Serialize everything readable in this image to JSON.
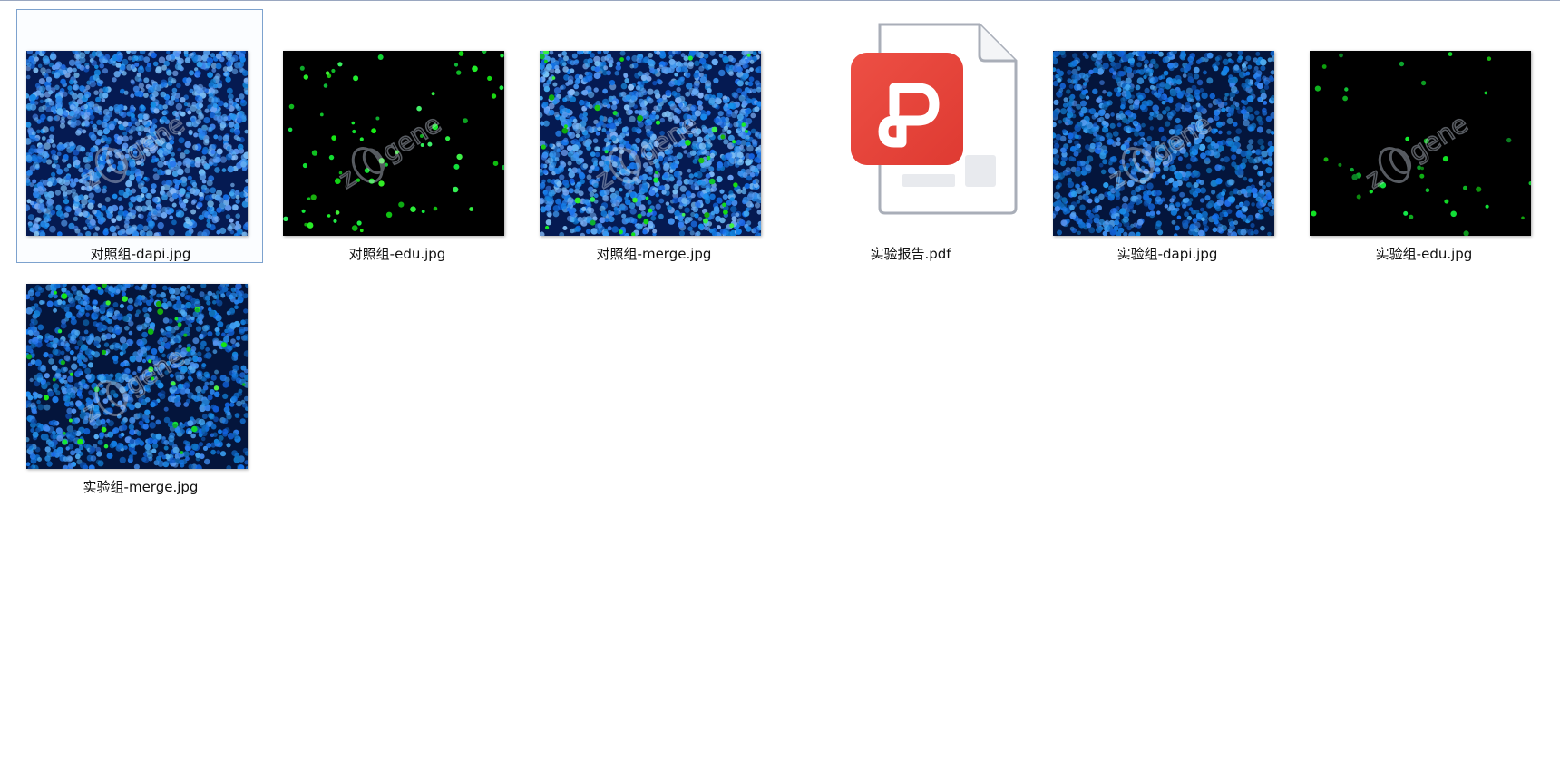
{
  "files": [
    {
      "name": "对照组-dapi.jpg",
      "kind": "dapi",
      "selected": true
    },
    {
      "name": "对照组-edu.jpg",
      "kind": "edu"
    },
    {
      "name": "对照组-merge.jpg",
      "kind": "merge"
    },
    {
      "name": "实验报告.pdf",
      "kind": "pdf"
    },
    {
      "name": "实验组-dapi.jpg",
      "kind": "dapi2"
    },
    {
      "name": "实验组-edu.jpg",
      "kind": "edu2"
    },
    {
      "name": "实验组-merge.jpg",
      "kind": "merge2"
    }
  ],
  "watermark": "zigene",
  "colors": {
    "selection_border": "#7da2ce",
    "pdf_red": "#e8453c",
    "nucleus_blue": "#2f8fe6",
    "edu_green": "#2fcf3a"
  }
}
